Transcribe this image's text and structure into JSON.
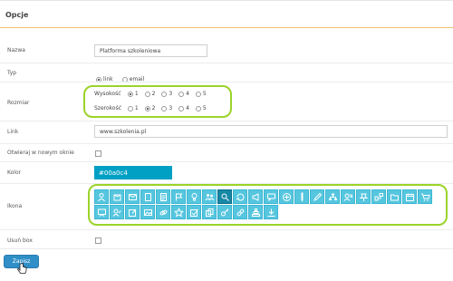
{
  "section": {
    "title": "Opcje"
  },
  "form": {
    "name": {
      "label": "Nazwa",
      "value": "Platforma szkoleniowa"
    },
    "type": {
      "label": "Typ",
      "options": [
        {
          "label": "link",
          "checked": true
        },
        {
          "label": "email",
          "checked": false
        }
      ]
    },
    "size": {
      "label": "Rozmiar",
      "height": {
        "label": "Wysokość",
        "options": [
          "1",
          "2",
          "3",
          "4",
          "5"
        ],
        "selected": "1"
      },
      "width": {
        "label": "Szerokość",
        "options": [
          "1",
          "2",
          "3",
          "4",
          "5"
        ],
        "selected": "2"
      }
    },
    "link": {
      "label": "Link",
      "value": "www.szkolenia.pl"
    },
    "new_window": {
      "label": "Otwieraj w nowym oknie",
      "checked": false
    },
    "color": {
      "label": "Kolor",
      "value": "#00a0c4"
    },
    "icon": {
      "label": "Ikona",
      "selected_index": 8,
      "icons": [
        "user-gear-icon",
        "box-icon",
        "envelope-icon",
        "document-icon",
        "document-lines-icon",
        "flag-icon",
        "lightbulb-icon",
        "people-icon",
        "user-search-icon",
        "refresh-icon",
        "megaphone-icon",
        "chat-icon",
        "plus-circle-icon",
        "pencil-vertical-icon",
        "pencil-icon",
        "org-chart-icon",
        "user-chart-icon",
        "pin-icon",
        "hierarchy-icon",
        "folder-icon",
        "calendar-icon",
        "cart-icon",
        "presentation-icon",
        "user-edit-icon",
        "edit-icon",
        "image-icon",
        "link-icon",
        "star-icon",
        "checkbox-icon",
        "copy-icon",
        "key-icon",
        "chain-icon",
        "pyramid-icon",
        "download-icon"
      ]
    },
    "remove_box": {
      "label": "Usuń box",
      "checked": false
    },
    "save_label": "Zapisz"
  },
  "colors": {
    "accent": "#00a0c4",
    "highlight": "#9bd32a",
    "button": "#2f8fc6",
    "rule": "#f0c06a"
  }
}
